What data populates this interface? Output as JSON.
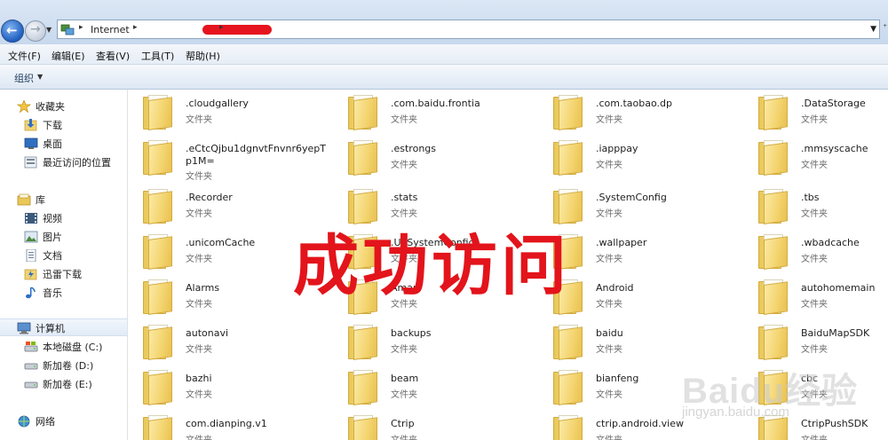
{
  "address_bar": {
    "breadcrumb": [
      "Internet"
    ],
    "separator": "▸"
  },
  "menu": {
    "items": [
      "文件(F)",
      "编辑(E)",
      "查看(V)",
      "工具(T)",
      "帮助(H)"
    ]
  },
  "toolbar": {
    "organize_label": "组织",
    "organize_arrow": "▼"
  },
  "nav": {
    "favorites": {
      "label": "收藏夹",
      "icon": "star-icon",
      "items": [
        {
          "label": "下载",
          "icon": "download-folder-icon"
        },
        {
          "label": "桌面",
          "icon": "desktop-icon"
        },
        {
          "label": "最近访问的位置",
          "icon": "recent-places-icon"
        }
      ]
    },
    "libraries": {
      "label": "库",
      "icon": "library-icon",
      "items": [
        {
          "label": "视频",
          "icon": "video-icon"
        },
        {
          "label": "图片",
          "icon": "pictures-icon"
        },
        {
          "label": "文档",
          "icon": "documents-icon"
        },
        {
          "label": "迅雷下载",
          "icon": "thunder-download-icon"
        },
        {
          "label": "音乐",
          "icon": "music-icon"
        }
      ]
    },
    "computer": {
      "label": "计算机",
      "icon": "computer-icon",
      "items": [
        {
          "label": "本地磁盘 (C:)",
          "icon": "local-disk-icon"
        },
        {
          "label": "新加卷 (D:)",
          "icon": "drive-icon"
        },
        {
          "label": "新加卷 (E:)",
          "icon": "drive-icon"
        }
      ]
    },
    "network": {
      "label": "网络",
      "icon": "network-icon"
    }
  },
  "folder_type_label": "文件夹",
  "folders": [
    ".cloudgallery",
    ".com.baidu.frontia",
    ".com.taobao.dp",
    ".DataStorage",
    ".eCtcQjbu1dgnvtFnvnr6yepTp1M=",
    ".estrongs",
    ".iapppay",
    ".mmsyscache",
    ".Recorder",
    ".stats",
    ".SystemConfig",
    ".tbs",
    ".unicomCache",
    ".UTSystemConfig",
    ".wallpaper",
    ".wbadcache",
    "Alarms",
    "Amap",
    "Android",
    "autohomemain",
    "autonavi",
    "backups",
    "baidu",
    "BaiduMapSDK",
    "bazhi",
    "beam",
    "bianfeng",
    "cbc",
    "com.dianping.v1",
    "Ctrip",
    "ctrip.android.view",
    "CtripPushSDK"
  ],
  "overlay_text": "成功访问",
  "watermark": {
    "logo": "Baidu经验",
    "url": "jingyan.baidu.com"
  }
}
